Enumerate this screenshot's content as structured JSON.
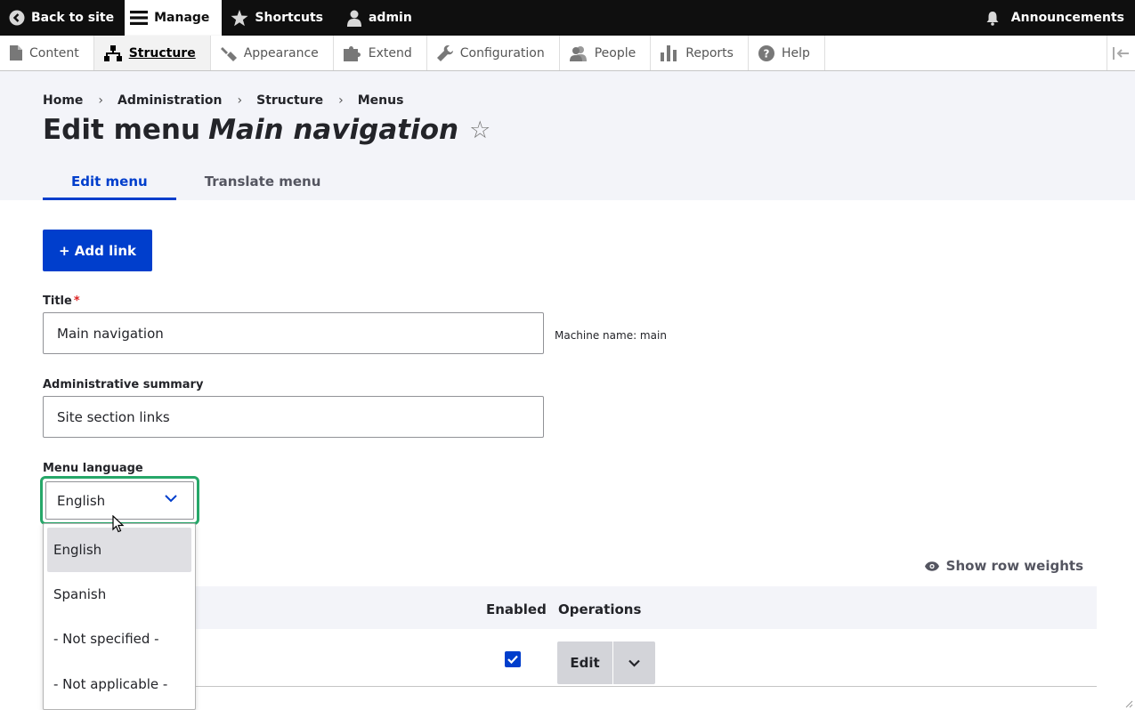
{
  "toolbar": {
    "back": "Back to site",
    "manage": "Manage",
    "shortcuts": "Shortcuts",
    "user": "admin",
    "announcements": "Announcements"
  },
  "tray": {
    "items": [
      "Content",
      "Structure",
      "Appearance",
      "Extend",
      "Configuration",
      "People",
      "Reports",
      "Help"
    ],
    "active": "Structure"
  },
  "breadcrumb": [
    "Home",
    "Administration",
    "Structure",
    "Menus"
  ],
  "page": {
    "title_prefix": "Edit menu",
    "title_menu": "Main navigation",
    "star": "☆"
  },
  "tabs": [
    "Edit menu",
    "Translate menu"
  ],
  "add_link_label": "+ Add link",
  "form": {
    "title_label": "Title",
    "title_required": "*",
    "title_value": "Main navigation",
    "machine_name": "Machine name: main",
    "summary_label": "Administrative summary",
    "summary_value": "Site section links",
    "language_label": "Menu language",
    "language_value": "English",
    "language_options": [
      "English",
      "Spanish",
      "- Not specified -",
      "- Not applicable -"
    ]
  },
  "table": {
    "show_row_weights": "Show row weights",
    "headers": {
      "enabled": "Enabled",
      "operations": "Operations"
    },
    "row": {
      "enabled": true,
      "edit_label": "Edit"
    }
  },
  "colors": {
    "primary": "#003ecc",
    "focus_ring": "#26a769",
    "toolbar_bg": "#0f0f0f"
  }
}
